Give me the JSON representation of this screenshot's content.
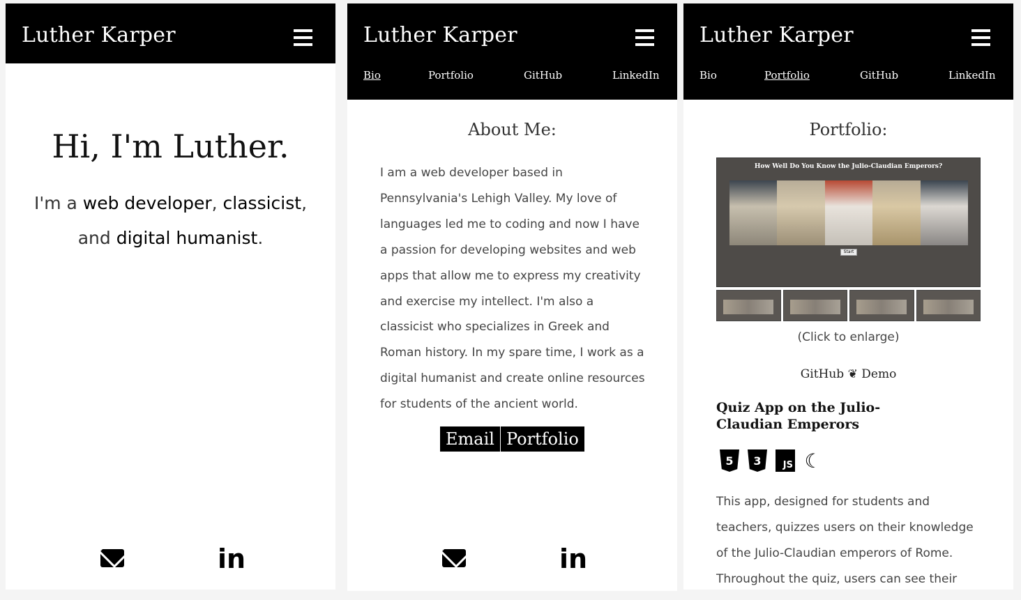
{
  "brand": "Luther Karper",
  "nav": [
    "Bio",
    "Portfolio",
    "GitHub",
    "LinkedIn"
  ],
  "panel1": {
    "title": "Hi, I'm Luther.",
    "sub": {
      "prefix": "I'm a ",
      "role1": "web developer",
      "sep1": ", ",
      "role2": "classicist",
      "sep2": ",",
      "and": "and ",
      "role3": "digital humanist",
      "end": "."
    }
  },
  "panel2": {
    "heading": "About Me:",
    "paragraph": "I am a web developer based in Pennsylvania's Lehigh Valley. My love of languages led me to coding and now I have a passion for developing websites and web apps that allow me to express my creativity and exercise my intellect. I'm also a classicist who specializes in Greek and Roman history. In my spare time, I work as a digital humanist and create online resources for students of the ancient world.",
    "buttons": [
      "Email",
      "Portfolio"
    ]
  },
  "panel3": {
    "heading": "Portfolio:",
    "screenshot_title": "How Well Do You Know the Julio-Claudian Emperors?",
    "screenshot_button": "Start",
    "enlarge": "(Click to enlarge)",
    "link_github": "GitHub",
    "link_sep": " ❦ ",
    "link_demo": "Demo",
    "project_title": "Quiz App on the Julio-Claudian Emperors",
    "tech_icons": [
      "html5-icon",
      "css3-icon",
      "javascript-icon",
      "jquery-icon"
    ],
    "tech_labels": [
      "5",
      "3",
      "JS",
      "☾"
    ],
    "description": "This app, designed for students and teachers, quizzes users on their knowledge of the Julio-Claudian emperors of Rome. Throughout the quiz, users can see their"
  },
  "footer_icons": [
    "envelope-icon",
    "linkedin-icon"
  ],
  "linkedin_glyph": "in",
  "colors": {
    "header": "#000000",
    "accent": "#000000",
    "text": "#444444"
  }
}
